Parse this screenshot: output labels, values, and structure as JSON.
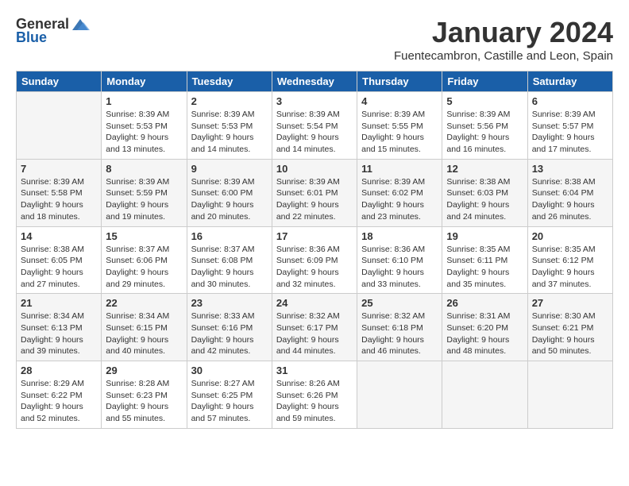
{
  "logo": {
    "general": "General",
    "blue": "Blue"
  },
  "header": {
    "month": "January 2024",
    "location": "Fuentecambron, Castille and Leon, Spain"
  },
  "columns": [
    "Sunday",
    "Monday",
    "Tuesday",
    "Wednesday",
    "Thursday",
    "Friday",
    "Saturday"
  ],
  "weeks": [
    {
      "bg": "white",
      "days": [
        {
          "date": "",
          "info": ""
        },
        {
          "date": "1",
          "info": "Sunrise: 8:39 AM\nSunset: 5:53 PM\nDaylight: 9 hours\nand 13 minutes."
        },
        {
          "date": "2",
          "info": "Sunrise: 8:39 AM\nSunset: 5:53 PM\nDaylight: 9 hours\nand 14 minutes."
        },
        {
          "date": "3",
          "info": "Sunrise: 8:39 AM\nSunset: 5:54 PM\nDaylight: 9 hours\nand 14 minutes."
        },
        {
          "date": "4",
          "info": "Sunrise: 8:39 AM\nSunset: 5:55 PM\nDaylight: 9 hours\nand 15 minutes."
        },
        {
          "date": "5",
          "info": "Sunrise: 8:39 AM\nSunset: 5:56 PM\nDaylight: 9 hours\nand 16 minutes."
        },
        {
          "date": "6",
          "info": "Sunrise: 8:39 AM\nSunset: 5:57 PM\nDaylight: 9 hours\nand 17 minutes."
        }
      ]
    },
    {
      "bg": "light",
      "days": [
        {
          "date": "7",
          "info": "Sunrise: 8:39 AM\nSunset: 5:58 PM\nDaylight: 9 hours\nand 18 minutes."
        },
        {
          "date": "8",
          "info": "Sunrise: 8:39 AM\nSunset: 5:59 PM\nDaylight: 9 hours\nand 19 minutes."
        },
        {
          "date": "9",
          "info": "Sunrise: 8:39 AM\nSunset: 6:00 PM\nDaylight: 9 hours\nand 20 minutes."
        },
        {
          "date": "10",
          "info": "Sunrise: 8:39 AM\nSunset: 6:01 PM\nDaylight: 9 hours\nand 22 minutes."
        },
        {
          "date": "11",
          "info": "Sunrise: 8:39 AM\nSunset: 6:02 PM\nDaylight: 9 hours\nand 23 minutes."
        },
        {
          "date": "12",
          "info": "Sunrise: 8:38 AM\nSunset: 6:03 PM\nDaylight: 9 hours\nand 24 minutes."
        },
        {
          "date": "13",
          "info": "Sunrise: 8:38 AM\nSunset: 6:04 PM\nDaylight: 9 hours\nand 26 minutes."
        }
      ]
    },
    {
      "bg": "white",
      "days": [
        {
          "date": "14",
          "info": "Sunrise: 8:38 AM\nSunset: 6:05 PM\nDaylight: 9 hours\nand 27 minutes."
        },
        {
          "date": "15",
          "info": "Sunrise: 8:37 AM\nSunset: 6:06 PM\nDaylight: 9 hours\nand 29 minutes."
        },
        {
          "date": "16",
          "info": "Sunrise: 8:37 AM\nSunset: 6:08 PM\nDaylight: 9 hours\nand 30 minutes."
        },
        {
          "date": "17",
          "info": "Sunrise: 8:36 AM\nSunset: 6:09 PM\nDaylight: 9 hours\nand 32 minutes."
        },
        {
          "date": "18",
          "info": "Sunrise: 8:36 AM\nSunset: 6:10 PM\nDaylight: 9 hours\nand 33 minutes."
        },
        {
          "date": "19",
          "info": "Sunrise: 8:35 AM\nSunset: 6:11 PM\nDaylight: 9 hours\nand 35 minutes."
        },
        {
          "date": "20",
          "info": "Sunrise: 8:35 AM\nSunset: 6:12 PM\nDaylight: 9 hours\nand 37 minutes."
        }
      ]
    },
    {
      "bg": "light",
      "days": [
        {
          "date": "21",
          "info": "Sunrise: 8:34 AM\nSunset: 6:13 PM\nDaylight: 9 hours\nand 39 minutes."
        },
        {
          "date": "22",
          "info": "Sunrise: 8:34 AM\nSunset: 6:15 PM\nDaylight: 9 hours\nand 40 minutes."
        },
        {
          "date": "23",
          "info": "Sunrise: 8:33 AM\nSunset: 6:16 PM\nDaylight: 9 hours\nand 42 minutes."
        },
        {
          "date": "24",
          "info": "Sunrise: 8:32 AM\nSunset: 6:17 PM\nDaylight: 9 hours\nand 44 minutes."
        },
        {
          "date": "25",
          "info": "Sunrise: 8:32 AM\nSunset: 6:18 PM\nDaylight: 9 hours\nand 46 minutes."
        },
        {
          "date": "26",
          "info": "Sunrise: 8:31 AM\nSunset: 6:20 PM\nDaylight: 9 hours\nand 48 minutes."
        },
        {
          "date": "27",
          "info": "Sunrise: 8:30 AM\nSunset: 6:21 PM\nDaylight: 9 hours\nand 50 minutes."
        }
      ]
    },
    {
      "bg": "white",
      "days": [
        {
          "date": "28",
          "info": "Sunrise: 8:29 AM\nSunset: 6:22 PM\nDaylight: 9 hours\nand 52 minutes."
        },
        {
          "date": "29",
          "info": "Sunrise: 8:28 AM\nSunset: 6:23 PM\nDaylight: 9 hours\nand 55 minutes."
        },
        {
          "date": "30",
          "info": "Sunrise: 8:27 AM\nSunset: 6:25 PM\nDaylight: 9 hours\nand 57 minutes."
        },
        {
          "date": "31",
          "info": "Sunrise: 8:26 AM\nSunset: 6:26 PM\nDaylight: 9 hours\nand 59 minutes."
        },
        {
          "date": "",
          "info": ""
        },
        {
          "date": "",
          "info": ""
        },
        {
          "date": "",
          "info": ""
        }
      ]
    }
  ]
}
